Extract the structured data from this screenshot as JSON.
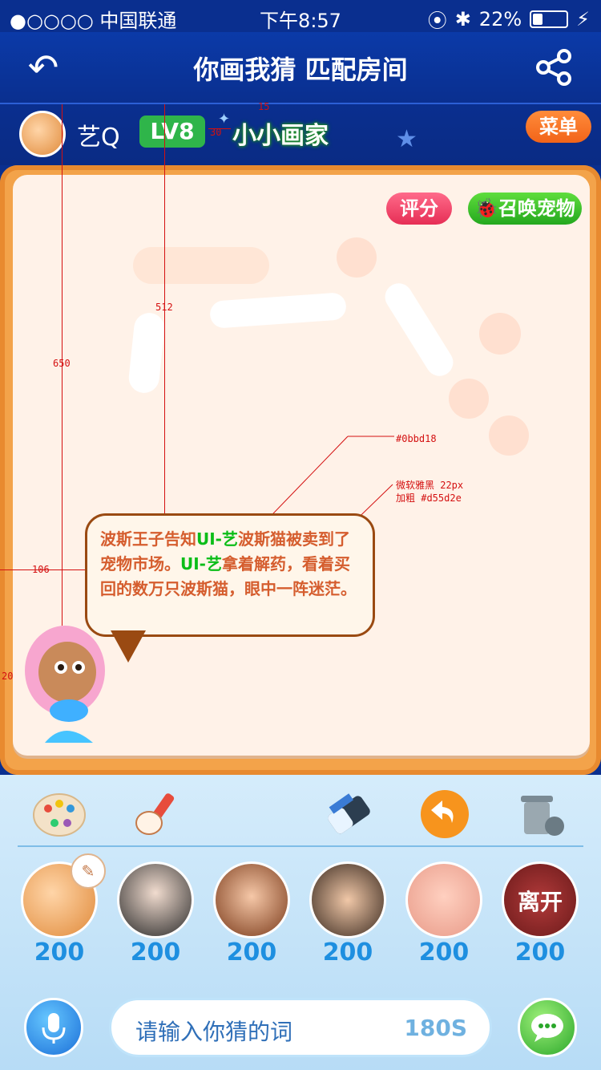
{
  "status_bar": {
    "carrier": "●○○○○ 中国联通",
    "time": "下午8:57",
    "battery": "22%"
  },
  "header": {
    "title": "你画我猜   匹配房间"
  },
  "user": {
    "name": "艺Q",
    "level": "LV8",
    "rank_title": "小小画家"
  },
  "menu_label": "菜单",
  "board": {
    "score_label": "评分",
    "summon_label": "召唤宠物"
  },
  "bubble": {
    "text_a": "波斯王子告知",
    "highlight_1": "UI-艺",
    "text_b": "波斯猫被卖到了宠物市场。",
    "highlight_2": "UI-艺",
    "text_c": "拿着解药，看着买回的数万只波斯猫，眼中一阵迷茫。"
  },
  "annotations": {
    "a15": "15",
    "a30": "30",
    "a512": "512",
    "a650": "650",
    "a106": "106",
    "a20": "20",
    "color_note": "#0bbd18",
    "font_note_1": "微软雅黑 22px",
    "font_note_2": "加粗 #d55d2e"
  },
  "players": [
    {
      "score": "200"
    },
    {
      "score": "200"
    },
    {
      "score": "200"
    },
    {
      "score": "200"
    },
    {
      "score": "200"
    },
    {
      "score": "200",
      "label": "离开"
    }
  ],
  "input": {
    "placeholder": "请输入你猜的词",
    "timer": "180S"
  },
  "colors": {
    "accent": "#0bbd18",
    "story_text": "#d55d2e",
    "board_frame": "#f3a34a"
  }
}
